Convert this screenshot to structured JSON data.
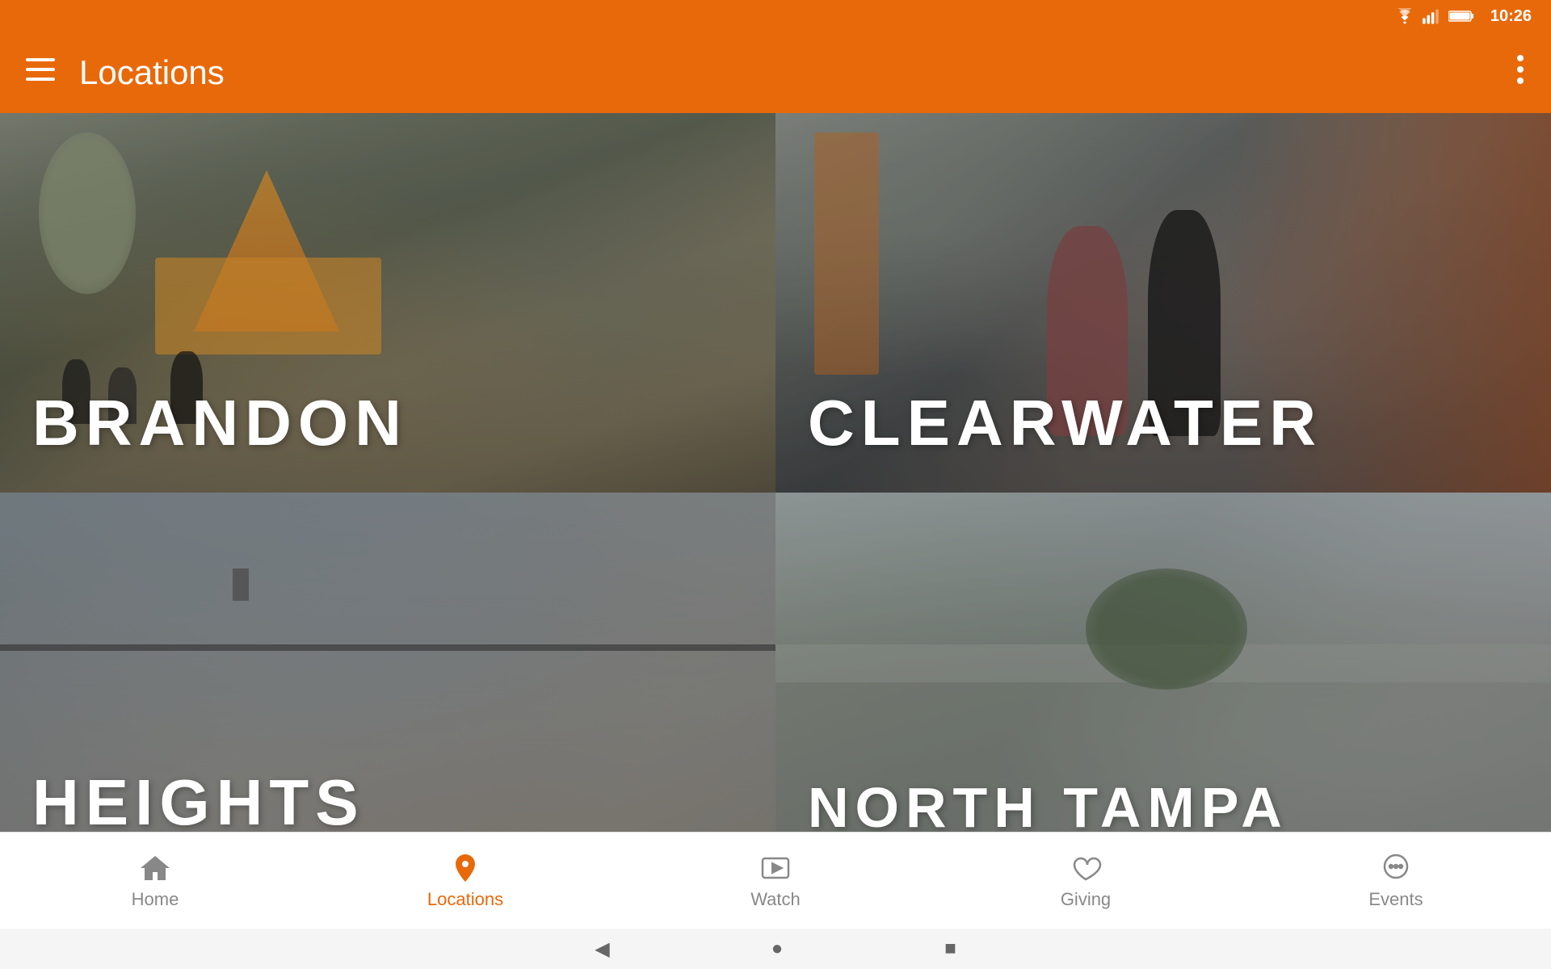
{
  "statusBar": {
    "time": "10:26",
    "wifiIcon": "wifi",
    "signalIcon": "signal",
    "batteryIcon": "battery"
  },
  "appBar": {
    "menuIcon": "hamburger-menu",
    "title": "Locations",
    "moreIcon": "more-vertical"
  },
  "locations": [
    {
      "id": "brandon",
      "label": "BRANDON",
      "cardClass": "card-brandon"
    },
    {
      "id": "clearwater",
      "label": "CLEARWATER",
      "cardClass": "card-clearwater"
    },
    {
      "id": "heights",
      "label": "HEIGHTS",
      "cardClass": "card-heights"
    },
    {
      "id": "northtampa",
      "label": "NORTH TAMPA",
      "cardClass": "card-northtampa"
    }
  ],
  "bottomNav": {
    "items": [
      {
        "id": "home",
        "label": "Home",
        "icon": "home",
        "active": false
      },
      {
        "id": "locations",
        "label": "Locations",
        "icon": "location-pin",
        "active": true
      },
      {
        "id": "watch",
        "label": "Watch",
        "icon": "play-circle",
        "active": false
      },
      {
        "id": "giving",
        "label": "Giving",
        "icon": "heart",
        "active": false
      },
      {
        "id": "events",
        "label": "Events",
        "icon": "chat-bubble",
        "active": false
      }
    ]
  },
  "sysNav": {
    "backIcon": "◀",
    "homeIcon": "●",
    "recentIcon": "■"
  }
}
